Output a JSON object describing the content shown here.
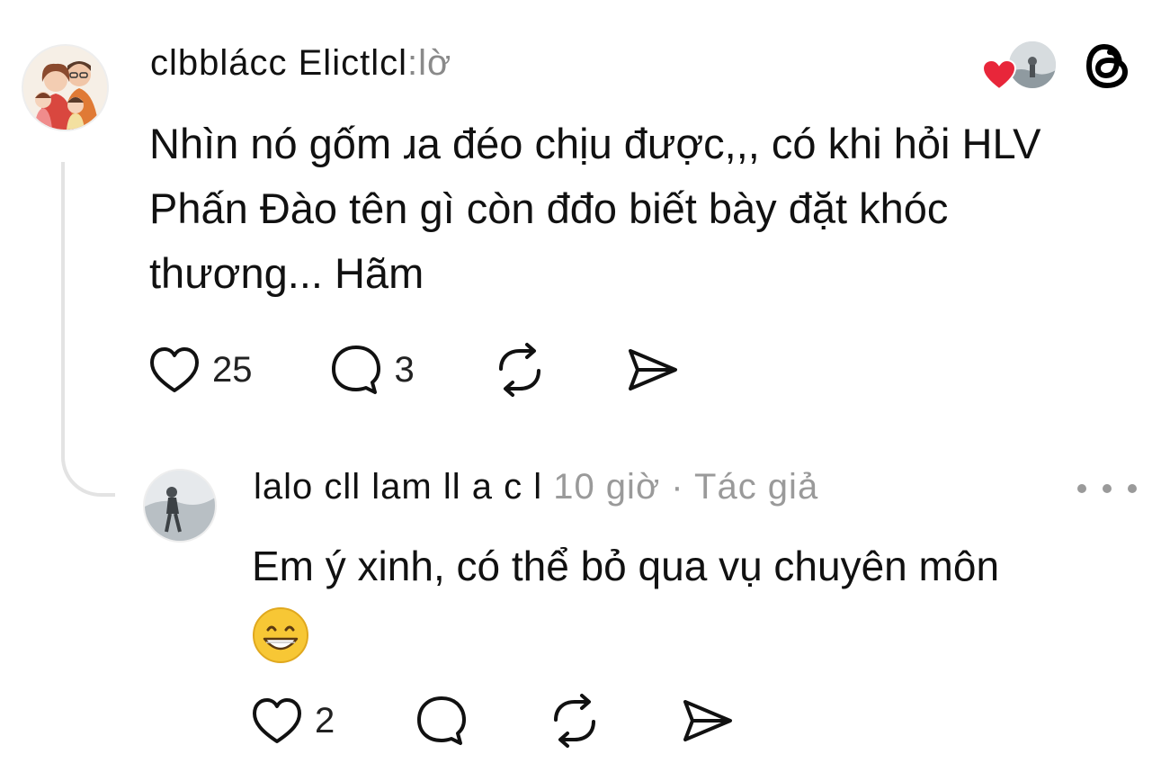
{
  "post": {
    "username": "clbblácc Elictlcl",
    "time": ":lờ",
    "text": "Nhìn nó gốm ɹa đéo chịu được,,, có khi hỏi HLV Phấn Đào tên gì còn đđo biết bày đặt khóc thương... Hãm",
    "likes": "25",
    "replies": "3",
    "icons": {
      "avatar": "family-cartoon-avatar",
      "liker": "liker-photo-avatar",
      "heart_badge": "red-heart-badge",
      "app_logo": "threads-logo"
    }
  },
  "reply": {
    "username": "lalo cll lam ll a c l",
    "time": "10 giờ",
    "separator": "·",
    "author_badge": "Tác giả",
    "text": "Em ý xinh, có thể bỏ qua vụ chuyên môn",
    "emoji": "grinning-face-emoji",
    "likes": "2"
  },
  "colors": {
    "text": "#111111",
    "muted": "#9a9a9a",
    "thread_line": "#e3e3e3",
    "heart_red": "#e8263a"
  }
}
